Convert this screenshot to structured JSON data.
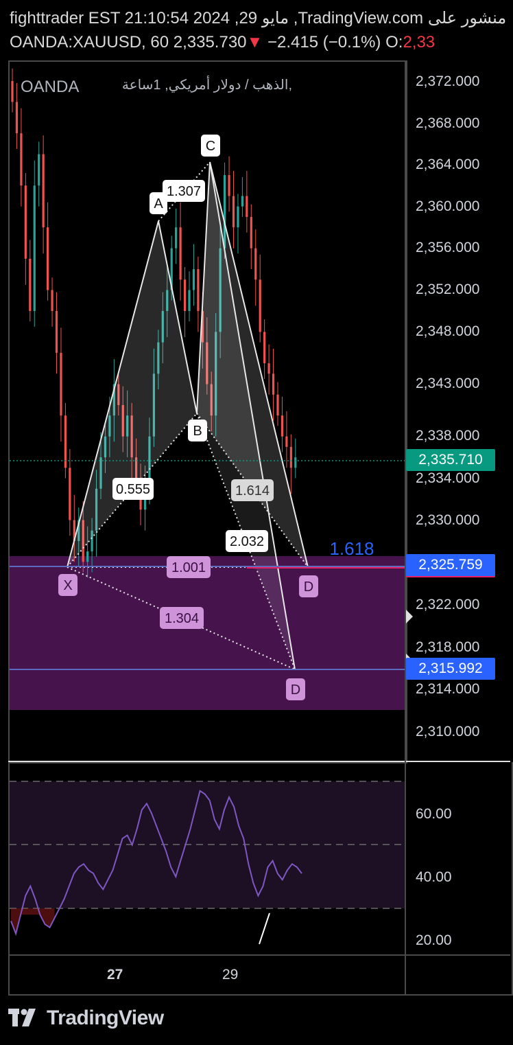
{
  "header": {
    "line1": "fighttrader EST 21:10:54 2024 ,29 مايو ,TradingView.com منشور على",
    "symbol": "OANDA:XAUUSD, 60",
    "last": "2,335.730",
    "change": "−2.415 (−0.1%)",
    "open_label": "O:",
    "open_value": "2,33"
  },
  "legend": {
    "broker": "OANDA",
    "symbol_name": "الذهب / دولار أمريكي, 1ساعة,"
  },
  "colors": {
    "up": "#26a69a",
    "down": "#ef5350",
    "zone": "#4a1450",
    "pattern_fill": "#ffffff",
    "rsi_line": "#7e57c2",
    "price_chip": "#089981",
    "blue_chip": "#2962ff"
  },
  "price_axis": {
    "ticks": [
      "2,372.000",
      "2,368.000",
      "2,364.000",
      "2,360.000",
      "2,356.000",
      "2,352.000",
      "2,348.000",
      "2,343.000",
      "2,338.000",
      "2,334.000",
      "2,330.000",
      "2,322.000",
      "2,318.000",
      "2,314.000",
      "2,310.000"
    ],
    "current_price": "2,335.710",
    "level_1": "2,325.759",
    "level_2": "2,315.992"
  },
  "rsi_axis": {
    "ticks": [
      "60.00",
      "40.00",
      "20.00"
    ]
  },
  "time_axis": {
    "ticks": [
      "27",
      "29"
    ]
  },
  "pattern": {
    "points": {
      "X": "X",
      "A": "A",
      "B": "B",
      "C": "C",
      "D1": "D",
      "D2": "D"
    },
    "ratios": {
      "ab": "1.307",
      "xb": "0.555",
      "bd": "1.614",
      "bd2": "2.032",
      "xd": "1.001",
      "xd2": "1.304",
      "ext": "1.618"
    }
  },
  "chart_data": {
    "type": "candlestick",
    "symbol": "OANDA:XAUUSD",
    "interval": "60",
    "ylim": [
      2308,
      2375
    ],
    "grid": false,
    "candles_close_approx": [
      2370,
      2367,
      2362,
      2355,
      2350,
      2362,
      2365,
      2358,
      2352,
      2350,
      2346,
      2340,
      2335,
      2330,
      2328,
      2330,
      2326,
      2327,
      2329,
      2333,
      2336,
      2338,
      2340,
      2343,
      2341,
      2338,
      2340,
      2336,
      2333,
      2331,
      2334,
      2338,
      2344,
      2347,
      2350,
      2352,
      2356,
      2358,
      2353,
      2350,
      2352,
      2354,
      2350,
      2347,
      2343,
      2340,
      2348,
      2356,
      2363,
      2361,
      2358,
      2360,
      2361,
      2359,
      2356,
      2353,
      2348,
      2345,
      2344,
      2342,
      2340,
      2338,
      2337,
      2335,
      2336
    ],
    "pattern_points": {
      "X": 2326.5,
      "A": 2358.5,
      "B": 2341.0,
      "C": 2364.5,
      "D1": 2325.9,
      "D2": 2316.0
    },
    "levels": [
      2325.759,
      2315.992
    ],
    "current_price": 2335.71,
    "rsi": {
      "levels": [
        70,
        50,
        30
      ],
      "values": [
        26,
        22,
        28,
        34,
        37,
        33,
        28,
        25,
        24,
        27,
        30,
        33,
        37,
        41,
        43,
        44,
        42,
        41,
        38,
        36,
        39,
        42,
        47,
        52,
        53,
        50,
        55,
        61,
        63,
        60,
        56,
        52,
        48,
        43,
        40,
        45,
        50,
        55,
        61,
        67,
        66,
        64,
        58,
        55,
        61,
        65,
        62,
        56,
        52,
        44,
        38,
        34,
        37,
        43,
        45,
        41,
        39,
        42,
        44,
        43,
        41
      ]
    }
  }
}
